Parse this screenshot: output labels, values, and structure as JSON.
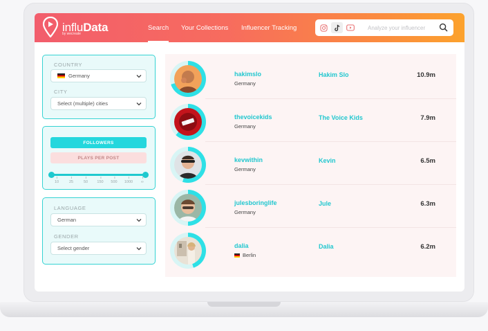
{
  "app": {
    "brand_prefix": "influ",
    "brand_suffix": "Data",
    "brand_sub": "by wecreate",
    "accent_gradient": [
      "#f25d6c",
      "#fca22d"
    ],
    "accent_teal": "#22c7cf"
  },
  "nav": {
    "search": "Search",
    "collections": "Your Collections",
    "tracking": "Influencer Tracking"
  },
  "search": {
    "platforms": [
      "instagram-icon",
      "tiktok-icon",
      "youtube-icon"
    ],
    "active_platform": "tiktok-icon",
    "placeholder": "Analyze your influencer"
  },
  "filters": {
    "country_label": "COUNTRY",
    "country_value": "Germany",
    "city_label": "CITY",
    "city_placeholder": "Select (multiple) cities",
    "followers_button": "FOLLOWERS",
    "plays_button": "PLAYS PER POST",
    "slider_ticks": [
      "10",
      "25",
      "50",
      "150",
      "500",
      "1000",
      "∞"
    ],
    "language_label": "LANGUAGE",
    "language_value": "German",
    "gender_label": "GENDER",
    "gender_placeholder": "Select gender"
  },
  "results": [
    {
      "username": "hakimslo",
      "location": "Germany",
      "display_name": "Hakim Slo",
      "followers": "10.9m",
      "score": 0.7,
      "flag": false
    },
    {
      "username": "thevoicekids",
      "location": "Germany",
      "display_name": "The Voice Kids",
      "followers": "7.9m",
      "score": 0.62,
      "flag": false
    },
    {
      "username": "kevwithin",
      "location": "Germany",
      "display_name": "Kevin",
      "followers": "6.5m",
      "score": 0.55,
      "flag": false
    },
    {
      "username": "julesboringlife",
      "location": "Germany",
      "display_name": "Jule",
      "followers": "6.3m",
      "score": 0.5,
      "flag": false
    },
    {
      "username": "dalia",
      "location": "Berlin",
      "display_name": "Dalia",
      "followers": "6.2m",
      "score": 0.45,
      "flag": true
    }
  ]
}
